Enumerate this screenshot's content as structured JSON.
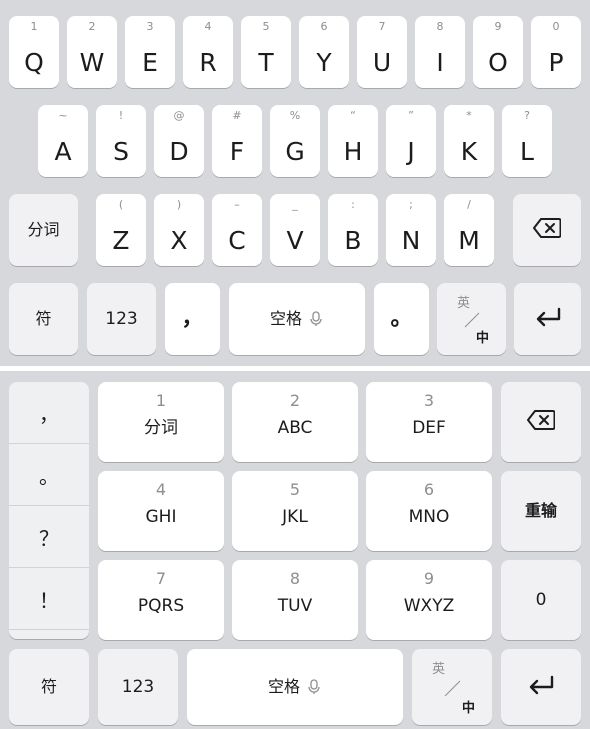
{
  "qwerty": {
    "row1": [
      {
        "main": "Q",
        "hint": "1"
      },
      {
        "main": "W",
        "hint": "2"
      },
      {
        "main": "E",
        "hint": "3"
      },
      {
        "main": "R",
        "hint": "4"
      },
      {
        "main": "T",
        "hint": "5"
      },
      {
        "main": "Y",
        "hint": "6"
      },
      {
        "main": "U",
        "hint": "7"
      },
      {
        "main": "I",
        "hint": "8"
      },
      {
        "main": "O",
        "hint": "9"
      },
      {
        "main": "P",
        "hint": "0"
      }
    ],
    "row2": [
      {
        "main": "A",
        "hint": "~"
      },
      {
        "main": "S",
        "hint": "!"
      },
      {
        "main": "D",
        "hint": "@"
      },
      {
        "main": "F",
        "hint": "#"
      },
      {
        "main": "G",
        "hint": "%"
      },
      {
        "main": "H",
        "hint": "“"
      },
      {
        "main": "J",
        "hint": "”"
      },
      {
        "main": "K",
        "hint": "*"
      },
      {
        "main": "L",
        "hint": "?"
      }
    ],
    "row3": [
      {
        "main": "Z",
        "hint": "("
      },
      {
        "main": "X",
        "hint": ")"
      },
      {
        "main": "C",
        "hint": "–"
      },
      {
        "main": "V",
        "hint": "_"
      },
      {
        "main": "B",
        "hint": ":"
      },
      {
        "main": "N",
        "hint": ";"
      },
      {
        "main": "M",
        "hint": "/"
      }
    ],
    "fenci": "分词",
    "symbol": "符",
    "num": "123",
    "comma": "，",
    "space": "空格",
    "period": "。",
    "lang_top": "英",
    "lang_bottom": "中"
  },
  "ninegrid": {
    "punct": [
      "，",
      "。",
      "？",
      "！"
    ],
    "keys": [
      {
        "num": "1",
        "label": "分词"
      },
      {
        "num": "2",
        "label": "ABC"
      },
      {
        "num": "3",
        "label": "DEF"
      },
      {
        "num": "4",
        "label": "GHI"
      },
      {
        "num": "5",
        "label": "JKL"
      },
      {
        "num": "6",
        "label": "MNO"
      },
      {
        "num": "7",
        "label": "PQRS"
      },
      {
        "num": "8",
        "label": "TUV"
      },
      {
        "num": "9",
        "label": "WXYZ"
      }
    ],
    "reenter": "重输",
    "zero": "0",
    "symbol": "符",
    "num": "123",
    "space": "空格",
    "lang_top": "英",
    "lang_bottom": "中"
  },
  "icons": {
    "backspace": "backspace-icon",
    "enter": "enter-icon",
    "mic": "mic-icon"
  },
  "colors": {
    "background": "#d7d8db",
    "key": "#ffffff",
    "function_key": "#f1f1f3",
    "hint": "#8e8e93"
  }
}
